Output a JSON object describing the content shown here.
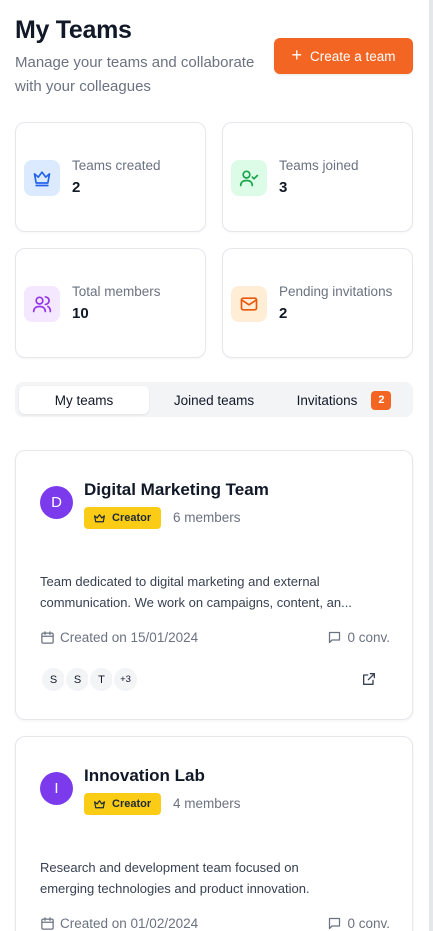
{
  "header": {
    "title": "My Teams",
    "subtitle": "Manage your teams and collaborate with your colleagues",
    "create_button": "Create a team",
    "create_button_icon": "plus-icon"
  },
  "stats": [
    {
      "label": "Teams created",
      "value": "2",
      "icon": "crown-icon",
      "icon_color": "#2563eb",
      "icon_bg": "#dbeafe"
    },
    {
      "label": "Teams joined",
      "value": "3",
      "icon": "user-check-icon",
      "icon_color": "#16a34a",
      "icon_bg": "#dcfce7"
    },
    {
      "label": "Total members",
      "value": "10",
      "icon": "users-icon",
      "icon_color": "#9333ea",
      "icon_bg": "#f3e8ff"
    },
    {
      "label": "Pending invitations",
      "value": "2",
      "icon": "mail-icon",
      "icon_color": "#ea580c",
      "icon_bg": "#ffedd5"
    }
  ],
  "tabs": {
    "items": [
      {
        "label": "My teams",
        "active": true
      },
      {
        "label": "Joined teams",
        "active": false
      },
      {
        "label": "Invitations",
        "active": false,
        "badge": "2"
      }
    ]
  },
  "teams": [
    {
      "initial": "D",
      "name": "Digital Marketing Team",
      "role": "Creator",
      "members": "6 members",
      "description_line1": "Team dedicated to digital marketing and external",
      "description_line2": "communication. We work on campaigns, content, an...",
      "created": "Created on 15/01/2024",
      "conversations": "0 conv.",
      "member_initials": [
        "S",
        "S",
        "T"
      ],
      "more_members": "+3"
    },
    {
      "initial": "I",
      "name": "Innovation Lab",
      "role": "Creator",
      "members": "4 members",
      "description_line1": "Research and development team focused on",
      "description_line2": "emerging technologies and product innovation.",
      "created": "Created on 01/02/2024",
      "conversations": "0 conv."
    }
  ],
  "colors": {
    "accent": "#f26522",
    "avatar": "#7c3aed",
    "creator_badge": "#facc15"
  }
}
